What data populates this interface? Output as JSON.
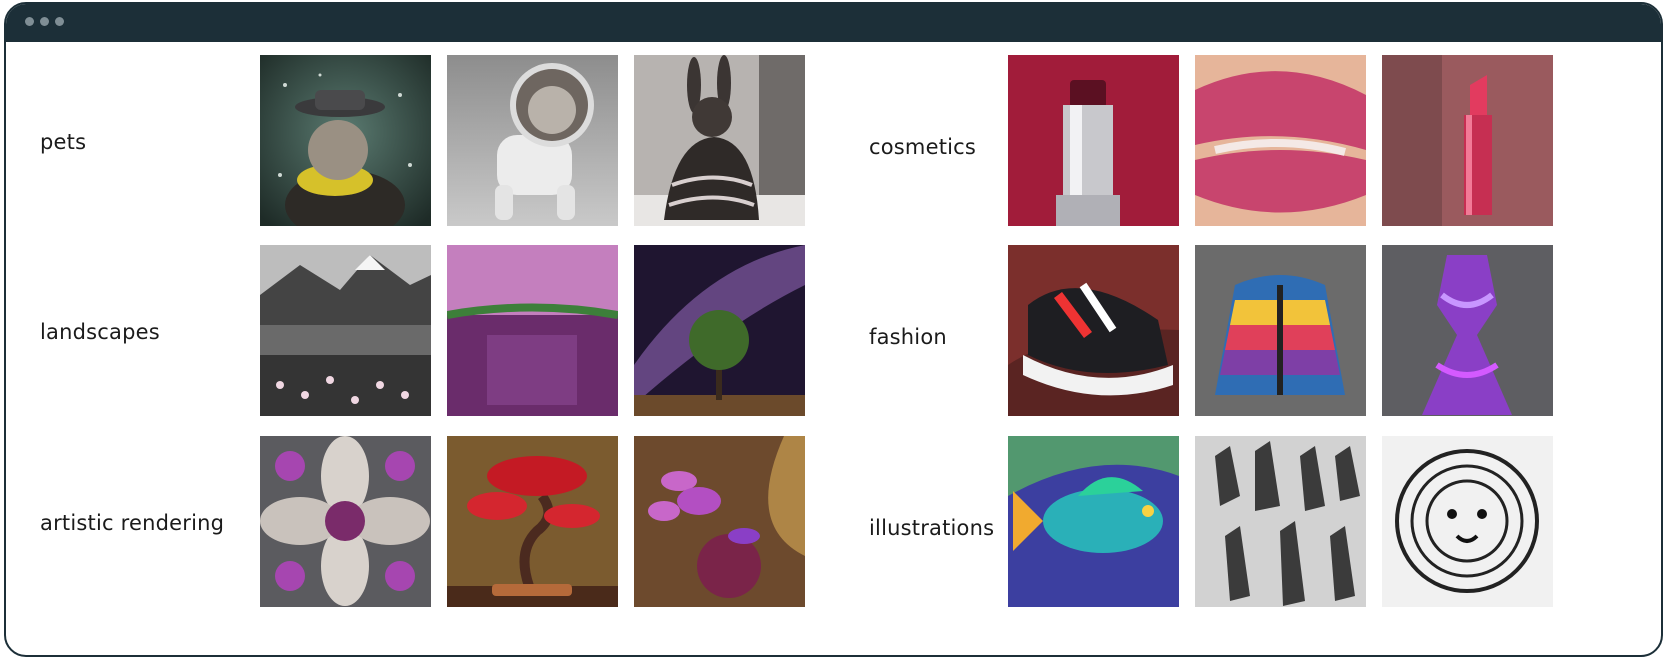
{
  "window": {
    "controls": [
      "dot",
      "dot",
      "dot"
    ]
  },
  "categories": {
    "pets": "pets",
    "landscapes": "landscapes",
    "artistic": "artistic rendering",
    "cosmetics": "cosmetics",
    "fashion": "fashion",
    "illustrations": "illustrations"
  },
  "colors": {
    "titlebar": "#1c2f38",
    "window_controls": "#7f8e95",
    "label_text": "#1b1b1b"
  }
}
